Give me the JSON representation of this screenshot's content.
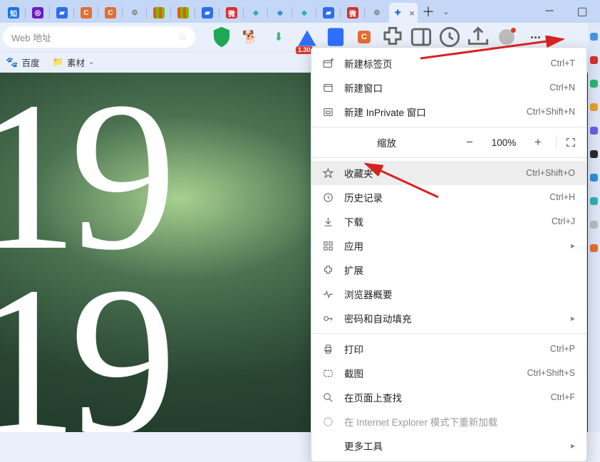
{
  "titlebar": {
    "tabs": [
      {
        "name": "知",
        "bg": "#1a73e8"
      },
      {
        "name": "◎",
        "bg": "#6b1abf"
      },
      {
        "name": "▰",
        "bg": "#2b6eeb"
      },
      {
        "name": "C",
        "bg": "#e56d31"
      },
      {
        "name": "C",
        "bg": "#e56d31"
      },
      {
        "name": "⚙",
        "bg": ""
      },
      {
        "name": "▦",
        "bg": ""
      },
      {
        "name": "▦",
        "bg": ""
      },
      {
        "name": "▰",
        "bg": "#2b6eeb"
      },
      {
        "name": "微",
        "bg": "#d83030"
      },
      {
        "name": "◆",
        "bg": "#2fb0b6"
      },
      {
        "name": "◆",
        "bg": "#2f8fd8"
      },
      {
        "name": "◆",
        "bg": "#2fb0b6"
      },
      {
        "name": "▰",
        "bg": "#2b6eeb"
      },
      {
        "name": "微",
        "bg": "#d83030"
      },
      {
        "name": "⚙",
        "bg": ""
      }
    ],
    "active_tab_label": "+",
    "new_tab": "＋",
    "dropdown": "⌄"
  },
  "addressbar": {
    "placeholder": "Web 地址"
  },
  "toolbar": {
    "badge": "1.30"
  },
  "bookmarks": {
    "item1": "百度",
    "item2": "素材"
  },
  "bignum_top": " 19",
  "bignum_bot": " 19",
  "menu": {
    "new_tab": "新建标签页",
    "sc_new_tab": "Ctrl+T",
    "new_win": "新建窗口",
    "sc_new_win": "Ctrl+N",
    "new_inpr": "新建 InPrivate 窗口",
    "sc_new_inpr": "Ctrl+Shift+N",
    "zoom": "缩放",
    "zoom_val": "100%",
    "fav": "收藏夹",
    "sc_fav": "Ctrl+Shift+O",
    "history": "历史记录",
    "sc_history": "Ctrl+H",
    "downloads": "下载",
    "sc_downloads": "Ctrl+J",
    "apps": "应用",
    "ext": "扩展",
    "perf": "浏览器概要",
    "pw": "密码和自动填充",
    "print": "打印",
    "sc_print": "Ctrl+P",
    "snip": "截图",
    "sc_snip": "Ctrl+Shift+S",
    "find": "在页面上查找",
    "sc_find": "Ctrl+F",
    "ie": "在 Internet Explorer 模式下重新加载",
    "more_tools": "更多工具"
  }
}
